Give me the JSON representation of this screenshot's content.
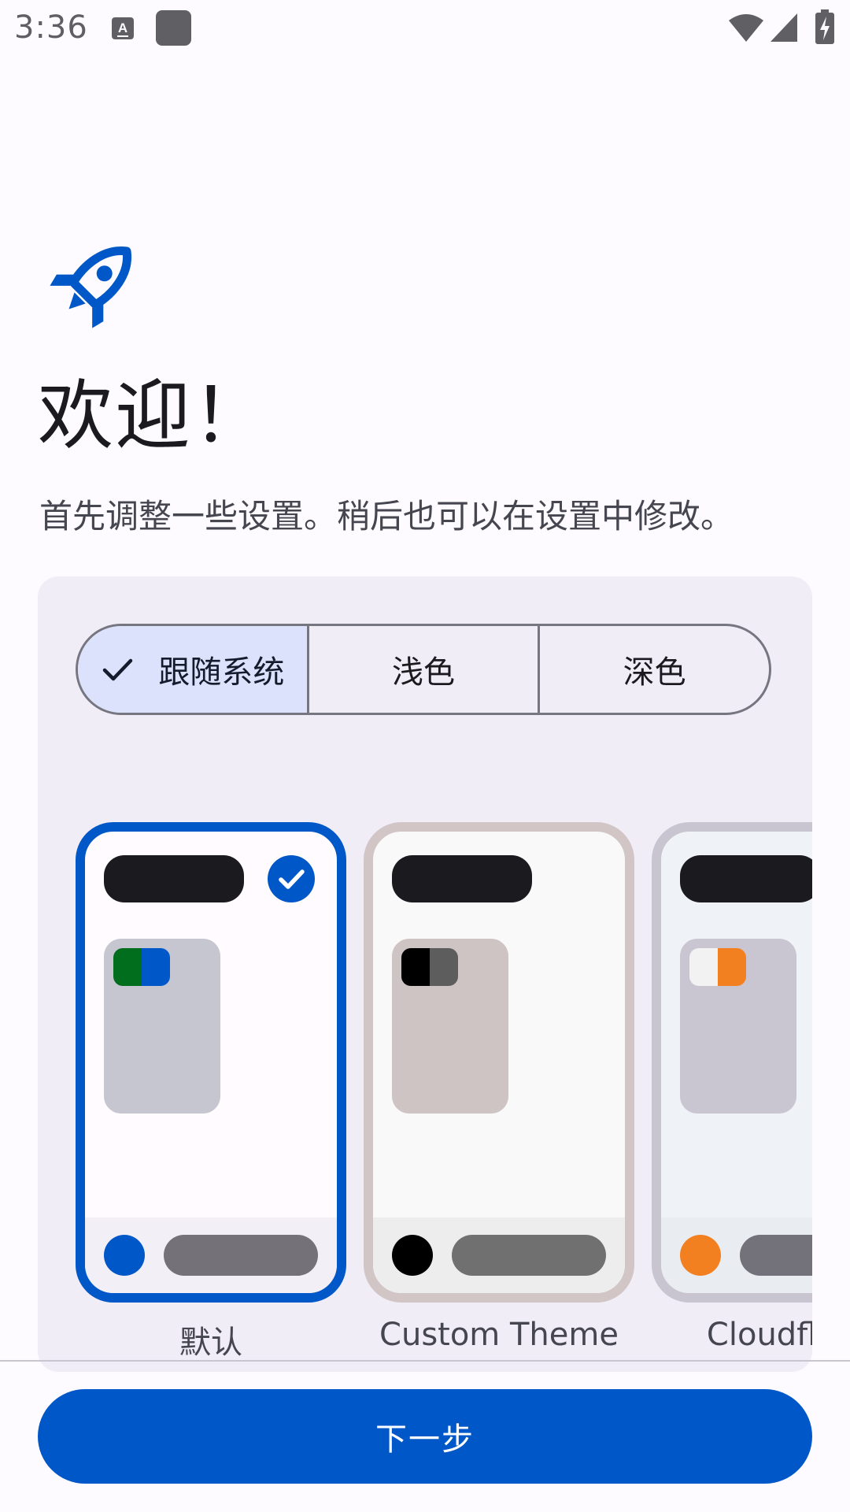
{
  "status_bar": {
    "time": "3:36",
    "icons": [
      "keyboard-a-icon",
      "app-square-icon",
      "wifi-icon",
      "signal-icon",
      "battery-charging-icon"
    ]
  },
  "header": {
    "icon": "rocket-icon",
    "title": "欢迎！",
    "subtitle": "首先调整一些设置。稍后也可以在设置中修改。"
  },
  "theme_mode": {
    "options": [
      {
        "label": "跟随系统",
        "selected": true
      },
      {
        "label": "浅色",
        "selected": false
      },
      {
        "label": "深色",
        "selected": false
      }
    ]
  },
  "themes": [
    {
      "name": "默认",
      "selected": true,
      "colors": {
        "border": "#0057c8",
        "background": "#fffbff",
        "bar": "#1b1b1f",
        "card": "#c5c6d0",
        "swatch": [
          "#006e1c",
          "#0057c8"
        ],
        "bottom": "#f3eff7",
        "dot": "#0057c8",
        "pill": "#747278"
      }
    },
    {
      "name": "Custom Theme",
      "selected": false,
      "colors": {
        "border": "#d1c5c5",
        "background": "#f9f9f9",
        "bar": "#1b1b1f",
        "card": "#cfc4c4",
        "swatch": [
          "#000000",
          "#5d5d5d"
        ],
        "bottom": "#ededed",
        "dot": "#000000",
        "pill": "#707070"
      }
    },
    {
      "name": "Cloudflare",
      "selected": false,
      "colors": {
        "border": "#c9c5d0",
        "background": "#eff3f7",
        "bar": "#1b1b1f",
        "card": "#c9c5d1",
        "swatch": [
          "#f2f2f2",
          "#f38020"
        ],
        "bottom": "#e9edf2",
        "dot": "#f38020",
        "pill": "#737179"
      }
    }
  ],
  "footer": {
    "next_label": "下一步"
  }
}
